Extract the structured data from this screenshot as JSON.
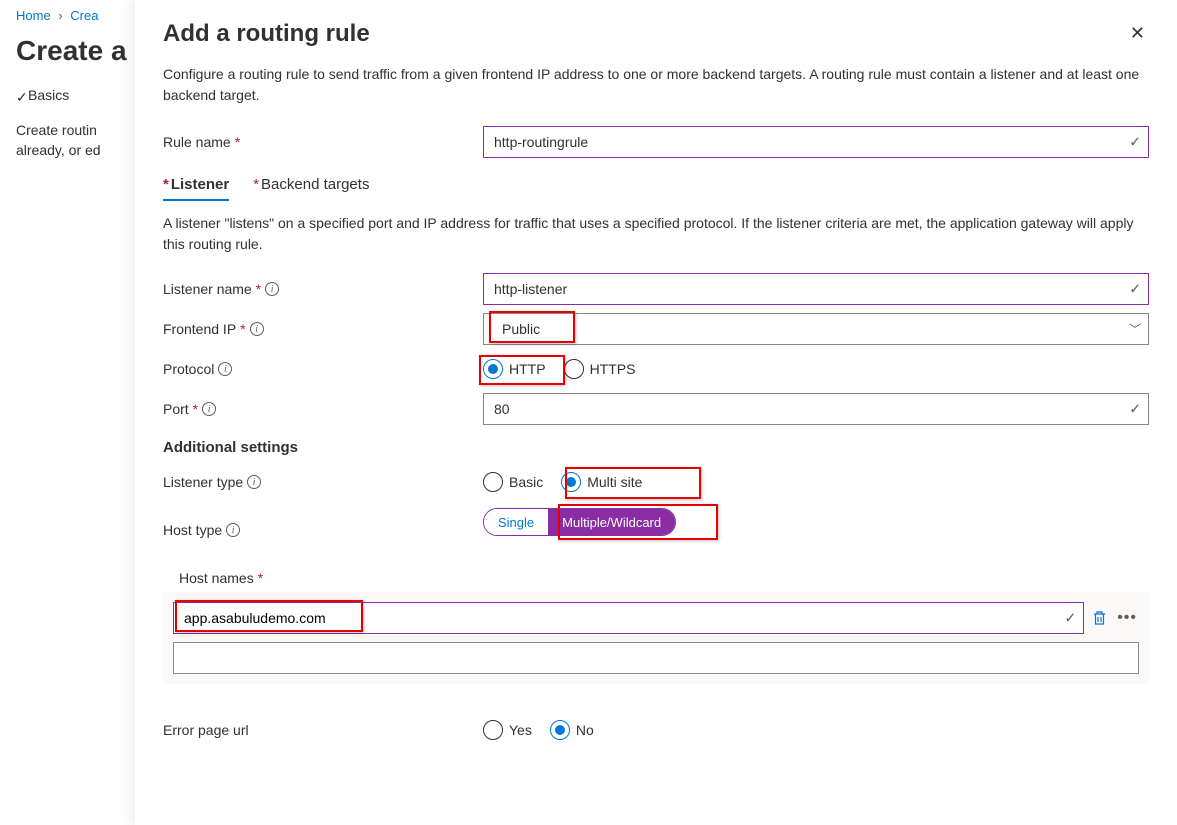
{
  "breadcrumb": {
    "home": "Home",
    "create": "Crea"
  },
  "page_title_truncated": "Create a",
  "basics_step": "Basics",
  "left_sub": "Create routin\nalready, or ed",
  "panel": {
    "title": "Add a routing rule",
    "description": "Configure a routing rule to send traffic from a given frontend IP address to one or more backend targets. A routing rule must contain a listener and at least one backend target.",
    "rule_name_label": "Rule name",
    "rule_name_value": "http-routingrule",
    "tabs": {
      "listener": "Listener",
      "backend": "Backend targets"
    },
    "listener_desc": "A listener \"listens\" on a specified port and IP address for traffic that uses a specified protocol. If the listener criteria are met, the application gateway will apply this routing rule.",
    "listener_name_label": "Listener name",
    "listener_name_value": "http-listener",
    "frontend_ip_label": "Frontend IP",
    "frontend_ip_value": "Public",
    "protocol_label": "Protocol",
    "protocol_http": "HTTP",
    "protocol_https": "HTTPS",
    "port_label": "Port",
    "port_value": "80",
    "additional_settings": "Additional settings",
    "listener_type_label": "Listener type",
    "listener_type_basic": "Basic",
    "listener_type_multi": "Multi site",
    "host_type_label": "Host type",
    "host_type_single": "Single",
    "host_type_multiple": "Multiple/Wildcard",
    "host_names_label": "Host names",
    "host_names": [
      "app.asabuludemo.com",
      ""
    ],
    "error_page_label": "Error page url",
    "error_page_yes": "Yes",
    "error_page_no": "No"
  }
}
